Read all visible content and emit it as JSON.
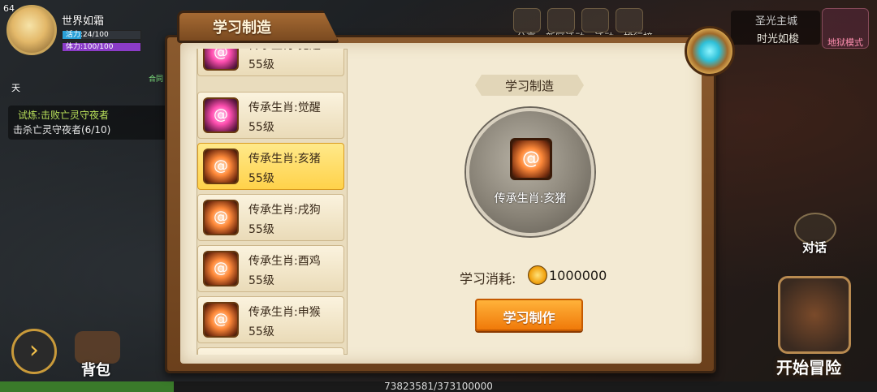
{
  "player": {
    "level": "64",
    "name": "世界如霜",
    "energy": "活力:24/100",
    "stamina": "体力:100/100",
    "energy_fraction": 0.24,
    "stamina_fraction": 1.0
  },
  "hud_left": {
    "day_text": "天",
    "gold_hint": "合同"
  },
  "quest": {
    "title": "试炼:击败亡灵守夜者",
    "progress": "击杀亡灵守夜者(6/10)"
  },
  "top_menu": {
    "items": [
      "分享",
      "新区活动",
      "活动",
      "排行榜"
    ]
  },
  "location": {
    "main": "圣光主城",
    "sub": "时光如梭"
  },
  "hell_mode": "地狱模式",
  "side": {
    "talk": "对话",
    "start_adventure": "开始冒险",
    "bag": "背包"
  },
  "exp": {
    "text": "73823581/373100000",
    "fraction": 0.198
  },
  "dialog": {
    "title": "学习制造",
    "list": [
      {
        "name": "传承生肖:觉醒",
        "level": "55级",
        "color": "pink",
        "selected": false
      },
      {
        "name": "传承生肖:觉醒",
        "level": "55级",
        "color": "pink",
        "selected": false
      },
      {
        "name": "传承生肖:亥猪",
        "level": "55级",
        "color": "orange",
        "selected": true
      },
      {
        "name": "传承生肖:戌狗",
        "level": "55级",
        "color": "orange",
        "selected": false
      },
      {
        "name": "传承生肖:酉鸡",
        "level": "55级",
        "color": "orange",
        "selected": false
      },
      {
        "name": "传承生肖:申猴",
        "level": "55级",
        "color": "orange",
        "selected": false
      }
    ],
    "detail": {
      "subtitle": "学习制造",
      "item_name": "传承生肖:亥猪",
      "cost_label": "学习消耗:",
      "cost_value": "1000000",
      "button": "学习制作"
    }
  }
}
